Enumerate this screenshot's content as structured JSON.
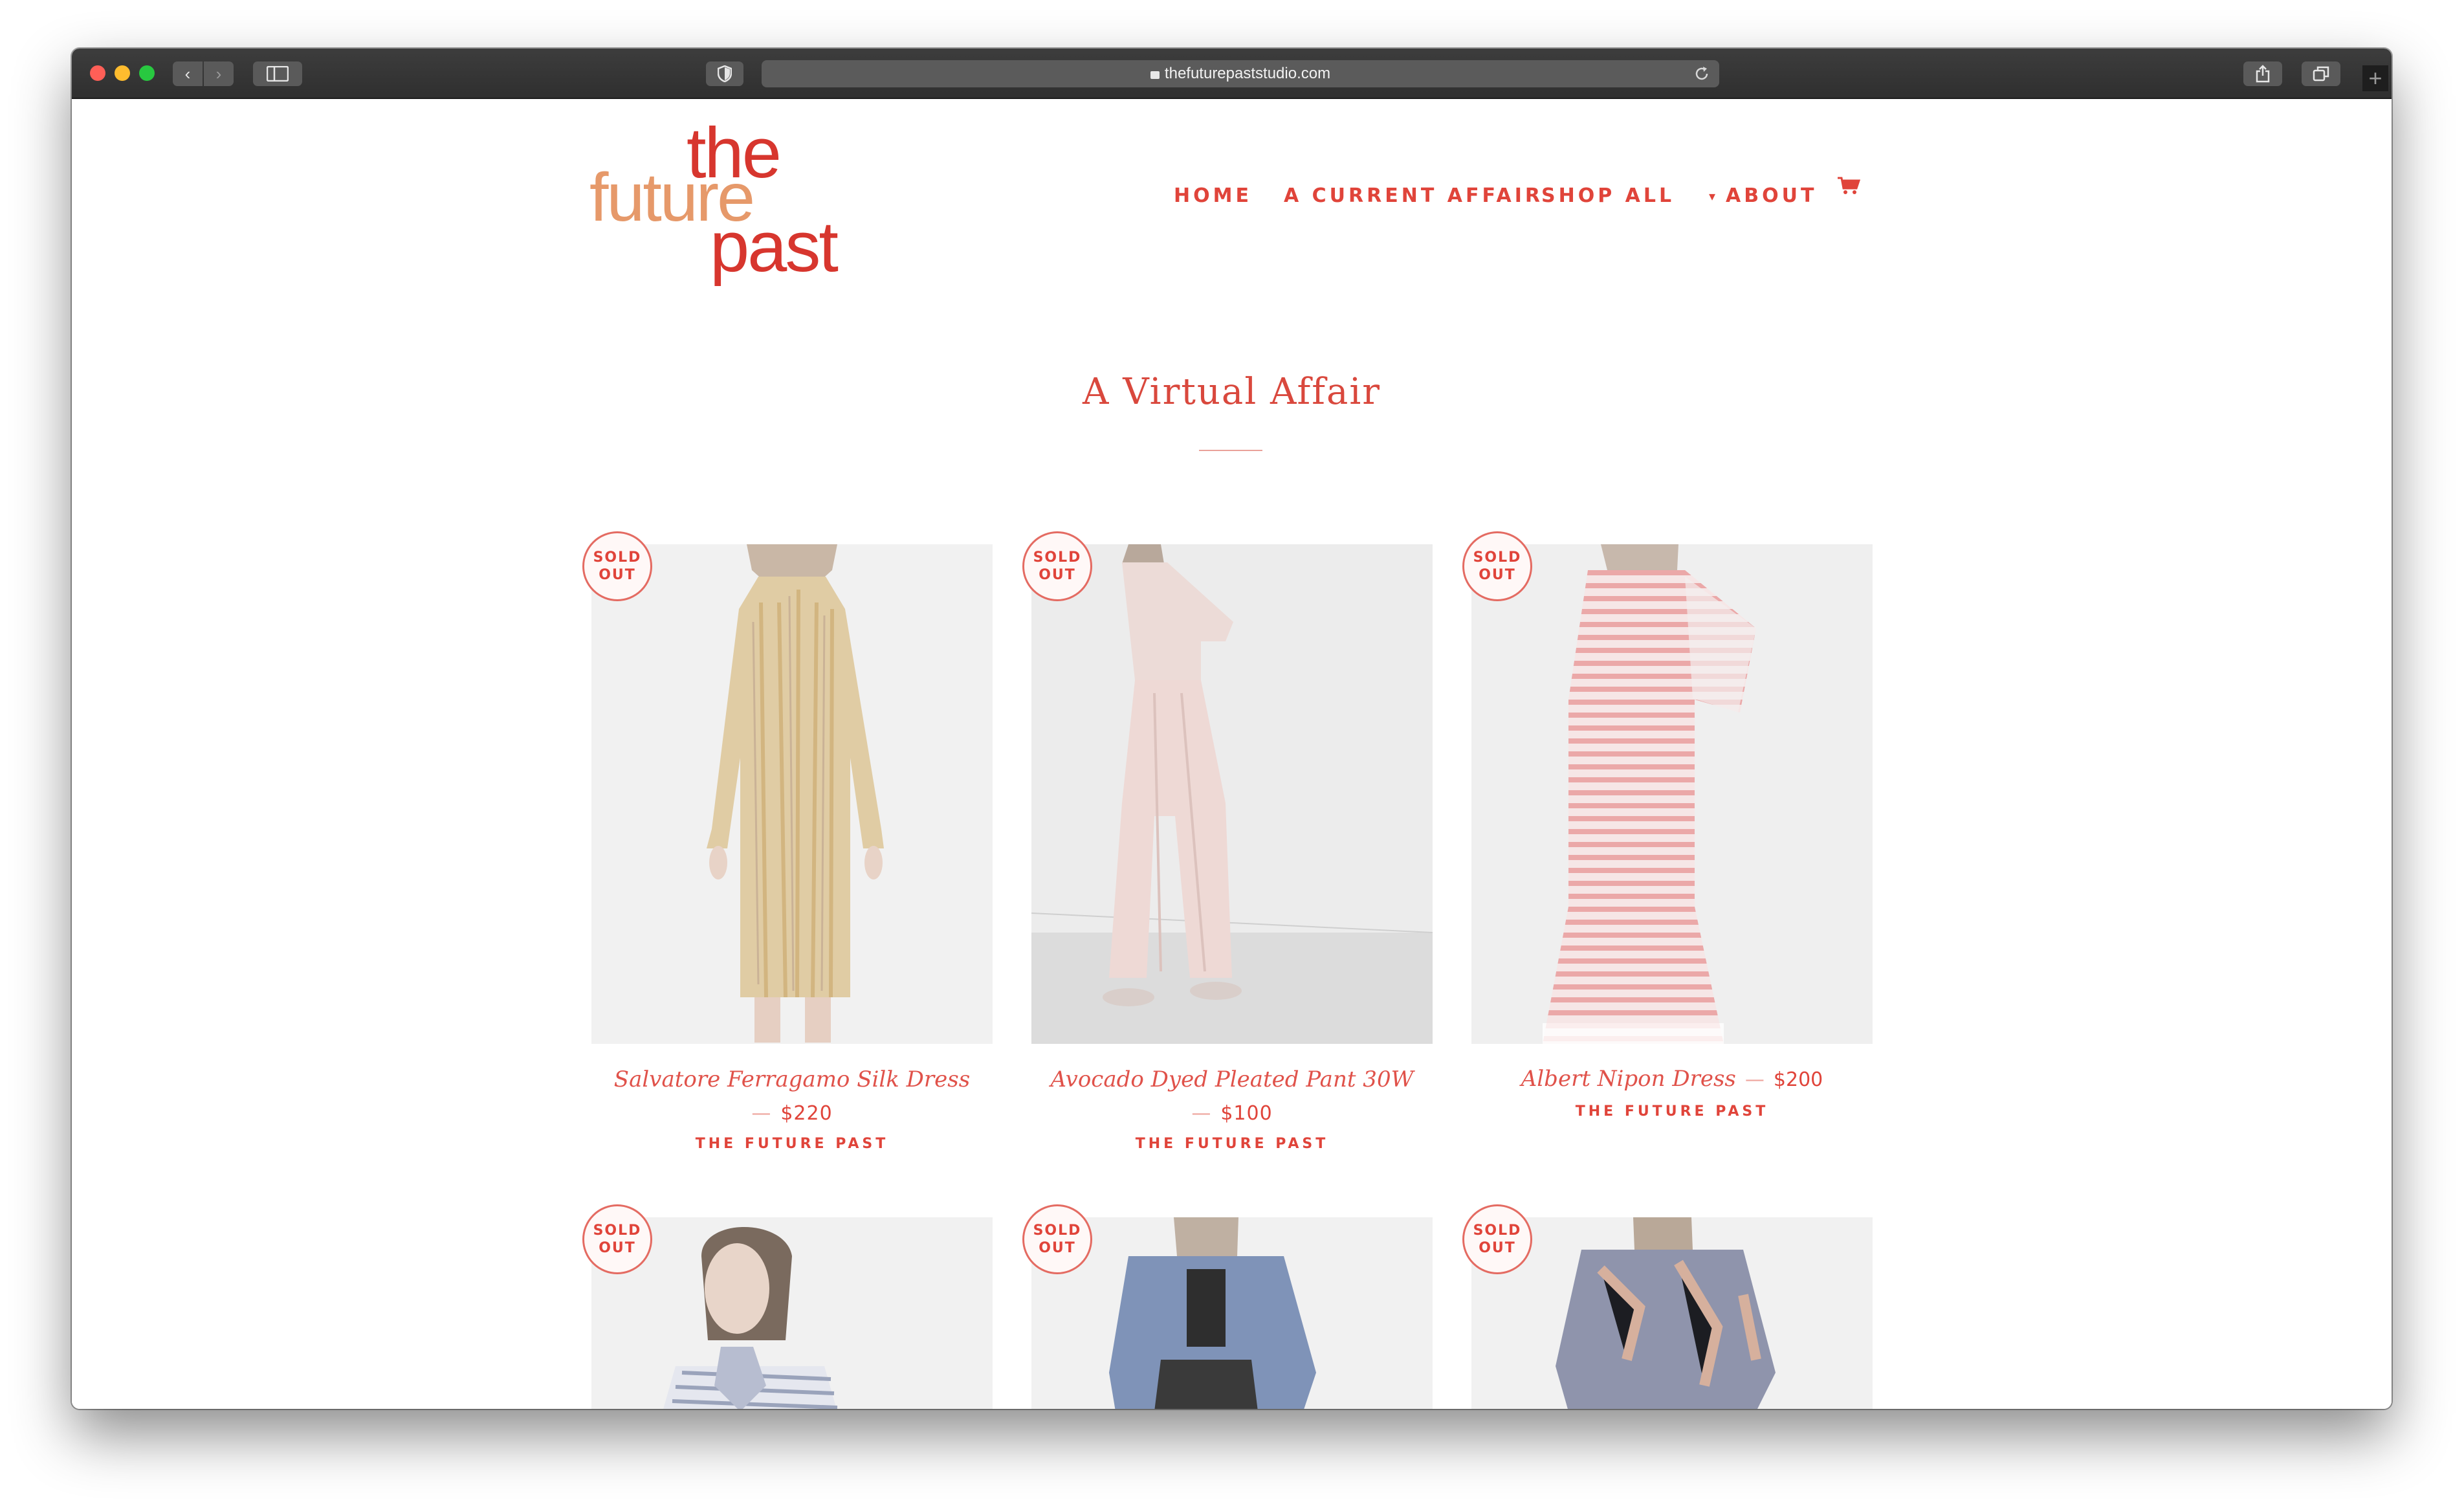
{
  "browser": {
    "url": "thefuturepaststudio.com",
    "back_icon": "‹",
    "forward_icon": "›"
  },
  "logo": {
    "line1": "the",
    "line2": "future",
    "line3": "past"
  },
  "nav": {
    "items": [
      "HOME",
      "A CURRENT AFFAIR",
      "SHOP ALL",
      "ABOUT"
    ],
    "caret": "▾"
  },
  "collection": {
    "title": "A Virtual Affair"
  },
  "products": [
    {
      "badge_line1": "SOLD",
      "badge_line2": "OUT",
      "name": "Salvatore Ferragamo Silk Dress",
      "price": "$220",
      "vendor": "THE FUTURE PAST"
    },
    {
      "badge_line1": "SOLD",
      "badge_line2": "OUT",
      "name": "Avocado Dyed Pleated Pant 30W",
      "price": "$100",
      "vendor": "THE FUTURE PAST"
    },
    {
      "badge_line1": "SOLD",
      "badge_line2": "OUT",
      "name": "Albert Nipon Dress",
      "price": "$200",
      "vendor": "THE FUTURE PAST"
    },
    {
      "badge_line1": "SOLD",
      "badge_line2": "OUT"
    },
    {
      "badge_line1": "SOLD",
      "badge_line2": "OUT"
    },
    {
      "badge_line1": "SOLD",
      "badge_line2": "OUT"
    }
  ],
  "colors": {
    "accent": "#e0443a",
    "logo_red": "#d7362e",
    "logo_orange": "#e6996a"
  }
}
